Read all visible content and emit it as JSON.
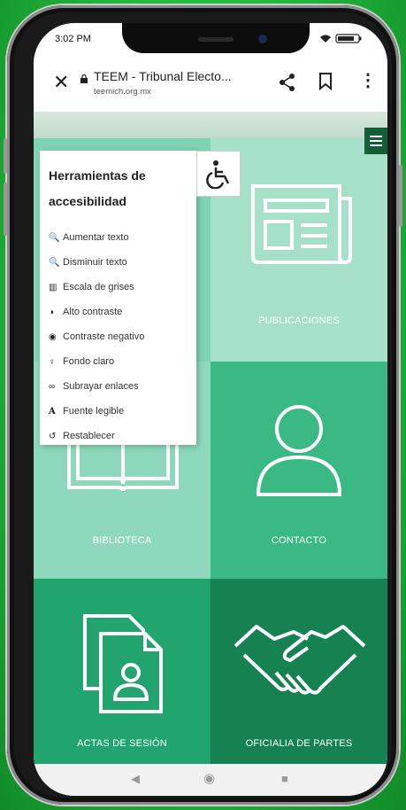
{
  "status_bar": {
    "time": "3:02 PM",
    "icons": "wifi signal battery"
  },
  "browser": {
    "page_title": "TEEM - Tribunal Electo...",
    "host": "teemich.org.mx",
    "close_icon": "close-icon",
    "share_icon": "share-icon",
    "bookmark_icon": "bookmark-icon",
    "menu_icon": "more-vertical-icon"
  },
  "accessibility_panel": {
    "title": "Herramientas de accesibilidad",
    "items": [
      {
        "icon": "zoom-in-icon",
        "label": "Aumentar texto"
      },
      {
        "icon": "zoom-out-icon",
        "label": "Disminuir texto"
      },
      {
        "icon": "grayscale-icon",
        "label": "Escala de grises"
      },
      {
        "icon": "contrast-icon",
        "label": "Alto contraste"
      },
      {
        "icon": "eye-icon",
        "label": "Contraste negativo"
      },
      {
        "icon": "lightbulb-icon",
        "label": "Fondo claro"
      },
      {
        "icon": "link-icon",
        "label": "Subrayar enlaces"
      },
      {
        "icon": "font-icon",
        "label": "Fuente legible"
      },
      {
        "icon": "reset-icon",
        "label": "Restablecer"
      }
    ]
  },
  "tiles": [
    {
      "label": "",
      "icon": "",
      "color": "#7fd3b4"
    },
    {
      "label": "PUBLICACIONES",
      "icon": "newspaper-icon",
      "color": "#a6e0c8"
    },
    {
      "label": "BIBLIOTECA",
      "icon": "book-icon",
      "color": "#8ed9bd"
    },
    {
      "label": "CONTACTO",
      "icon": "person-icon",
      "color": "#3bb985"
    },
    {
      "label": "ACTAS DE SESIÓN",
      "icon": "documents-icon",
      "color": "#22a46e"
    },
    {
      "label": "OFICIALIA DE PARTES",
      "icon": "handshake-icon",
      "color": "#168252"
    }
  ],
  "colors": {
    "accent": "#145e36",
    "background": "#22b83c"
  }
}
